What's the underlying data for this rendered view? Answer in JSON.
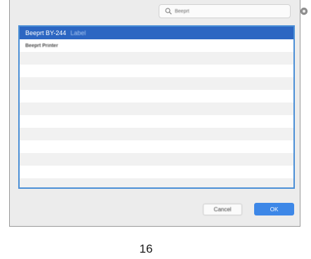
{
  "search": {
    "value": "Beeprt"
  },
  "printer_list": {
    "rows": [
      {
        "name": "Beeprt BY-244",
        "kind": "Label",
        "selected": true
      },
      {
        "name": "Beeprt Printer",
        "selected": false
      }
    ],
    "empty_row_count": 11
  },
  "buttons": {
    "cancel_label": "Cancel",
    "ok_label": "OK"
  },
  "page_number": "16",
  "colors": {
    "selection": "#2c66c2",
    "list_focus_border": "#4b8fd6",
    "primary_button": "#3d87e7"
  },
  "icons": {
    "search": "magnifier-icon",
    "clear": "gear-icon"
  }
}
